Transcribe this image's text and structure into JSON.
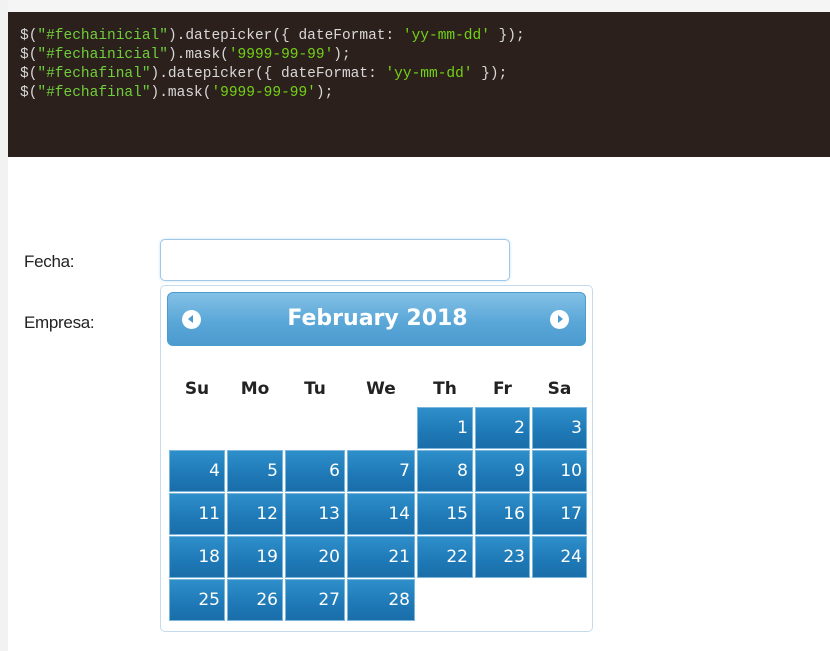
{
  "code": {
    "lines": [
      [
        {
          "t": "$(",
          "c": "fn"
        },
        {
          "t": "\"#fechainicial\"",
          "c": "sel"
        },
        {
          "t": ").datepicker({ dateFormat: ",
          "c": "fn"
        },
        {
          "t": "'yy-mm-dd'",
          "c": "str"
        },
        {
          "t": " });",
          "c": "fn"
        }
      ],
      [
        {
          "t": "$(",
          "c": "fn"
        },
        {
          "t": "\"#fechainicial\"",
          "c": "sel"
        },
        {
          "t": ").mask(",
          "c": "fn"
        },
        {
          "t": "'9999-99-99'",
          "c": "str"
        },
        {
          "t": ");",
          "c": "fn"
        }
      ],
      [
        {
          "t": "$(",
          "c": "fn"
        },
        {
          "t": "\"#fechafinal\"",
          "c": "sel"
        },
        {
          "t": ").datepicker({ dateFormat: ",
          "c": "fn"
        },
        {
          "t": "'yy-mm-dd'",
          "c": "str"
        },
        {
          "t": " });",
          "c": "fn"
        }
      ],
      [
        {
          "t": "$(",
          "c": "fn"
        },
        {
          "t": "\"#fechafinal\"",
          "c": "sel"
        },
        {
          "t": ").mask(",
          "c": "fn"
        },
        {
          "t": "'9999-99-99'",
          "c": "str"
        },
        {
          "t": ");",
          "c": "fn"
        }
      ]
    ]
  },
  "form": {
    "fecha_label": "Fecha:",
    "fecha_value": "",
    "empresa_label": "Empresa:"
  },
  "datepicker": {
    "title": "February 2018",
    "weekdays": [
      "Su",
      "Mo",
      "Tu",
      "We",
      "Th",
      "Fr",
      "Sa"
    ],
    "first_weekday_index": 4,
    "days_in_month": 28,
    "colors": {
      "day_bg": "#1e79b6",
      "header_bg": "#5aa7d8"
    }
  },
  "icons": {
    "prev": "circle-triangle-left-icon",
    "next": "circle-triangle-right-icon"
  }
}
